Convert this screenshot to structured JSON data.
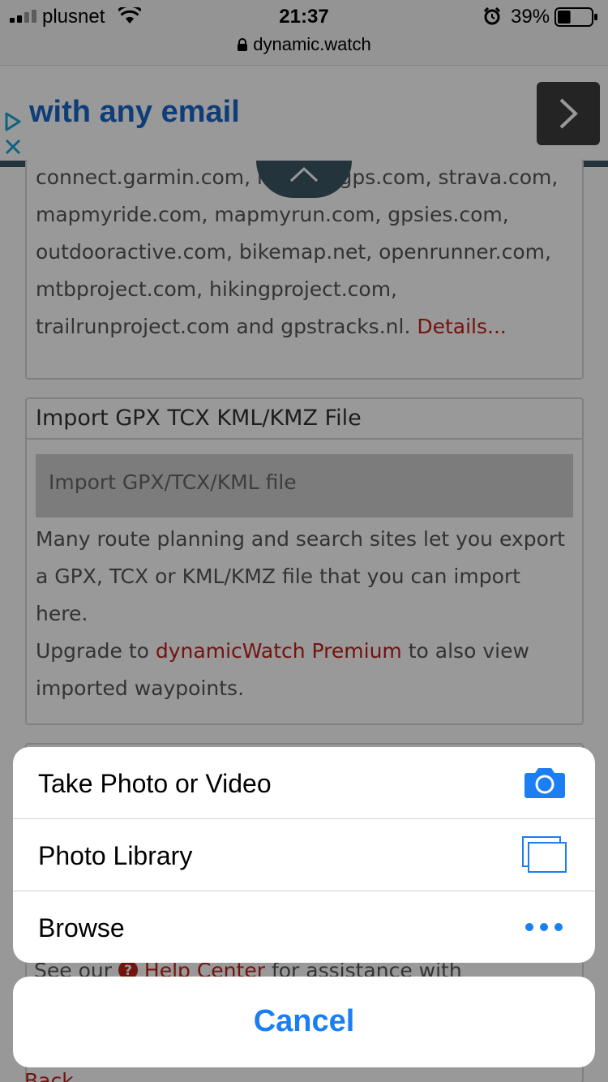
{
  "status_bar": {
    "carrier": "plusnet",
    "time": "21:37",
    "battery_percent": "39%",
    "battery_level": 0.39
  },
  "browser": {
    "url": "dynamic.watch"
  },
  "ad": {
    "title": "with any email"
  },
  "page": {
    "sites_text": "connect.garmin.com, ridewithgps.com, strava.com, mapmyride.com, mapmyrun.com, gpsies.com, outdooractive.com, bikemap.net, openrunner.com, mtbproject.com, hikingproject.com, trailrunproject.com and gpstracks.nl.",
    "details_link": "Details...",
    "import_panel": {
      "title": "Import GPX TCX KML/KMZ File",
      "button_label": "Import GPX/TCX/KML file",
      "description": "Many route planning and search sites let you export a GPX, TCX or KML/KMZ file that you can import here.",
      "upgrade_prefix": "Upgrade to",
      "premium_link": "dynamicWatch Premium",
      "upgrade_suffix": "to also view imported waypoints."
    },
    "help_prefix": "See our",
    "help_link": "Help Center",
    "help_suffix": "for assistance with",
    "back_link": "Back"
  },
  "action_sheet": {
    "items": [
      {
        "label": "Take Photo or Video",
        "icon": "camera-icon"
      },
      {
        "label": "Photo Library",
        "icon": "photo-library-icon"
      },
      {
        "label": "Browse",
        "icon": "more-icon"
      }
    ],
    "cancel_label": "Cancel"
  },
  "colors": {
    "ios_blue": "#1b7ef2",
    "link_red": "#c0201a",
    "ad_blue": "#1a66c8"
  }
}
